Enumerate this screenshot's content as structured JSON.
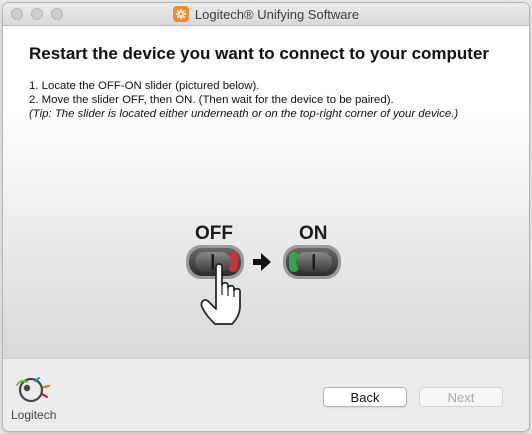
{
  "window": {
    "title": "Logitech® Unifying Software"
  },
  "content": {
    "headline": "Restart the device you want to connect to your computer",
    "step1": "1. Locate the OFF-ON slider (pictured below).",
    "step2": "2. Move the slider OFF, then ON. (Then wait for the device to be paired).",
    "tip": "(Tip: The slider is located either underneath or on the top-right corner of your device.)",
    "illustration": {
      "off_label": "OFF",
      "on_label": "ON"
    }
  },
  "footer": {
    "logo_text": "Logitech",
    "back_label": "Back",
    "next_label": "Next"
  },
  "colors": {
    "off_indicator": "#d0303a",
    "on_indicator": "#2fa84a",
    "brand_orange": "#f28c28"
  }
}
